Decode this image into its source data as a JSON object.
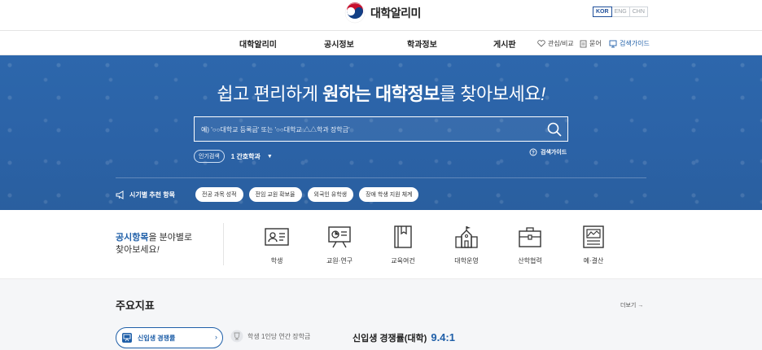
{
  "header": {
    "logo_text": "대학알리미",
    "languages": [
      "KOR",
      "ENG",
      "CHN"
    ],
    "active_language": "KOR"
  },
  "nav": {
    "items": [
      "대학알리미",
      "공시정보",
      "학과정보",
      "게시판"
    ],
    "utilities": [
      {
        "label": "관심/비교",
        "icon": "heart-icon"
      },
      {
        "label": "묻어",
        "icon": "document-icon"
      },
      {
        "label": "검색가이드",
        "icon": "monitor-icon"
      }
    ]
  },
  "hero": {
    "headline_prefix": "쉽고 편리하게 ",
    "headline_bold": "원하는 대학정보",
    "headline_suffix": "를 찾아보세요",
    "headline_end": "!",
    "search_placeholder": "예) '○○대학교 등록금' 또는 '○○대학교 △△학과 장학금'",
    "popular_badge": "인기검색",
    "popular_keyword": "1 간호학과",
    "guide_label": "검색가이드",
    "recommend_label": "시기별 추천 항목",
    "chips": [
      "전공 과목 성적",
      "전임 교원 확보율",
      "외국인 유학생",
      "장애 학생 지원 체계"
    ],
    "colors": {
      "background": "#2c64a8",
      "text": "#ffffff"
    }
  },
  "categories": {
    "title_highlight": "공시항목",
    "title_rest": "을 분야별로",
    "title_line2": "찾아보세요",
    "title_end": "!",
    "items": [
      {
        "label": "학생",
        "icon": "student-card-icon"
      },
      {
        "label": "교원·연구",
        "icon": "presentation-board-icon"
      },
      {
        "label": "교육여건",
        "icon": "book-icon"
      },
      {
        "label": "대학운영",
        "icon": "university-building-icon"
      },
      {
        "label": "산학협력",
        "icon": "briefcase-icon"
      },
      {
        "label": "예·결산",
        "icon": "budget-chart-icon"
      }
    ]
  },
  "indicators": {
    "title": "주요지표",
    "more": "더보기 →",
    "selected_metric": "신입생 경쟁률",
    "alt_metric": "학생 1인당 연간 장학금",
    "value_label": "신입생 경쟁률(대학)",
    "value": "9.4:1",
    "accent_color": "#1f5fa8"
  }
}
